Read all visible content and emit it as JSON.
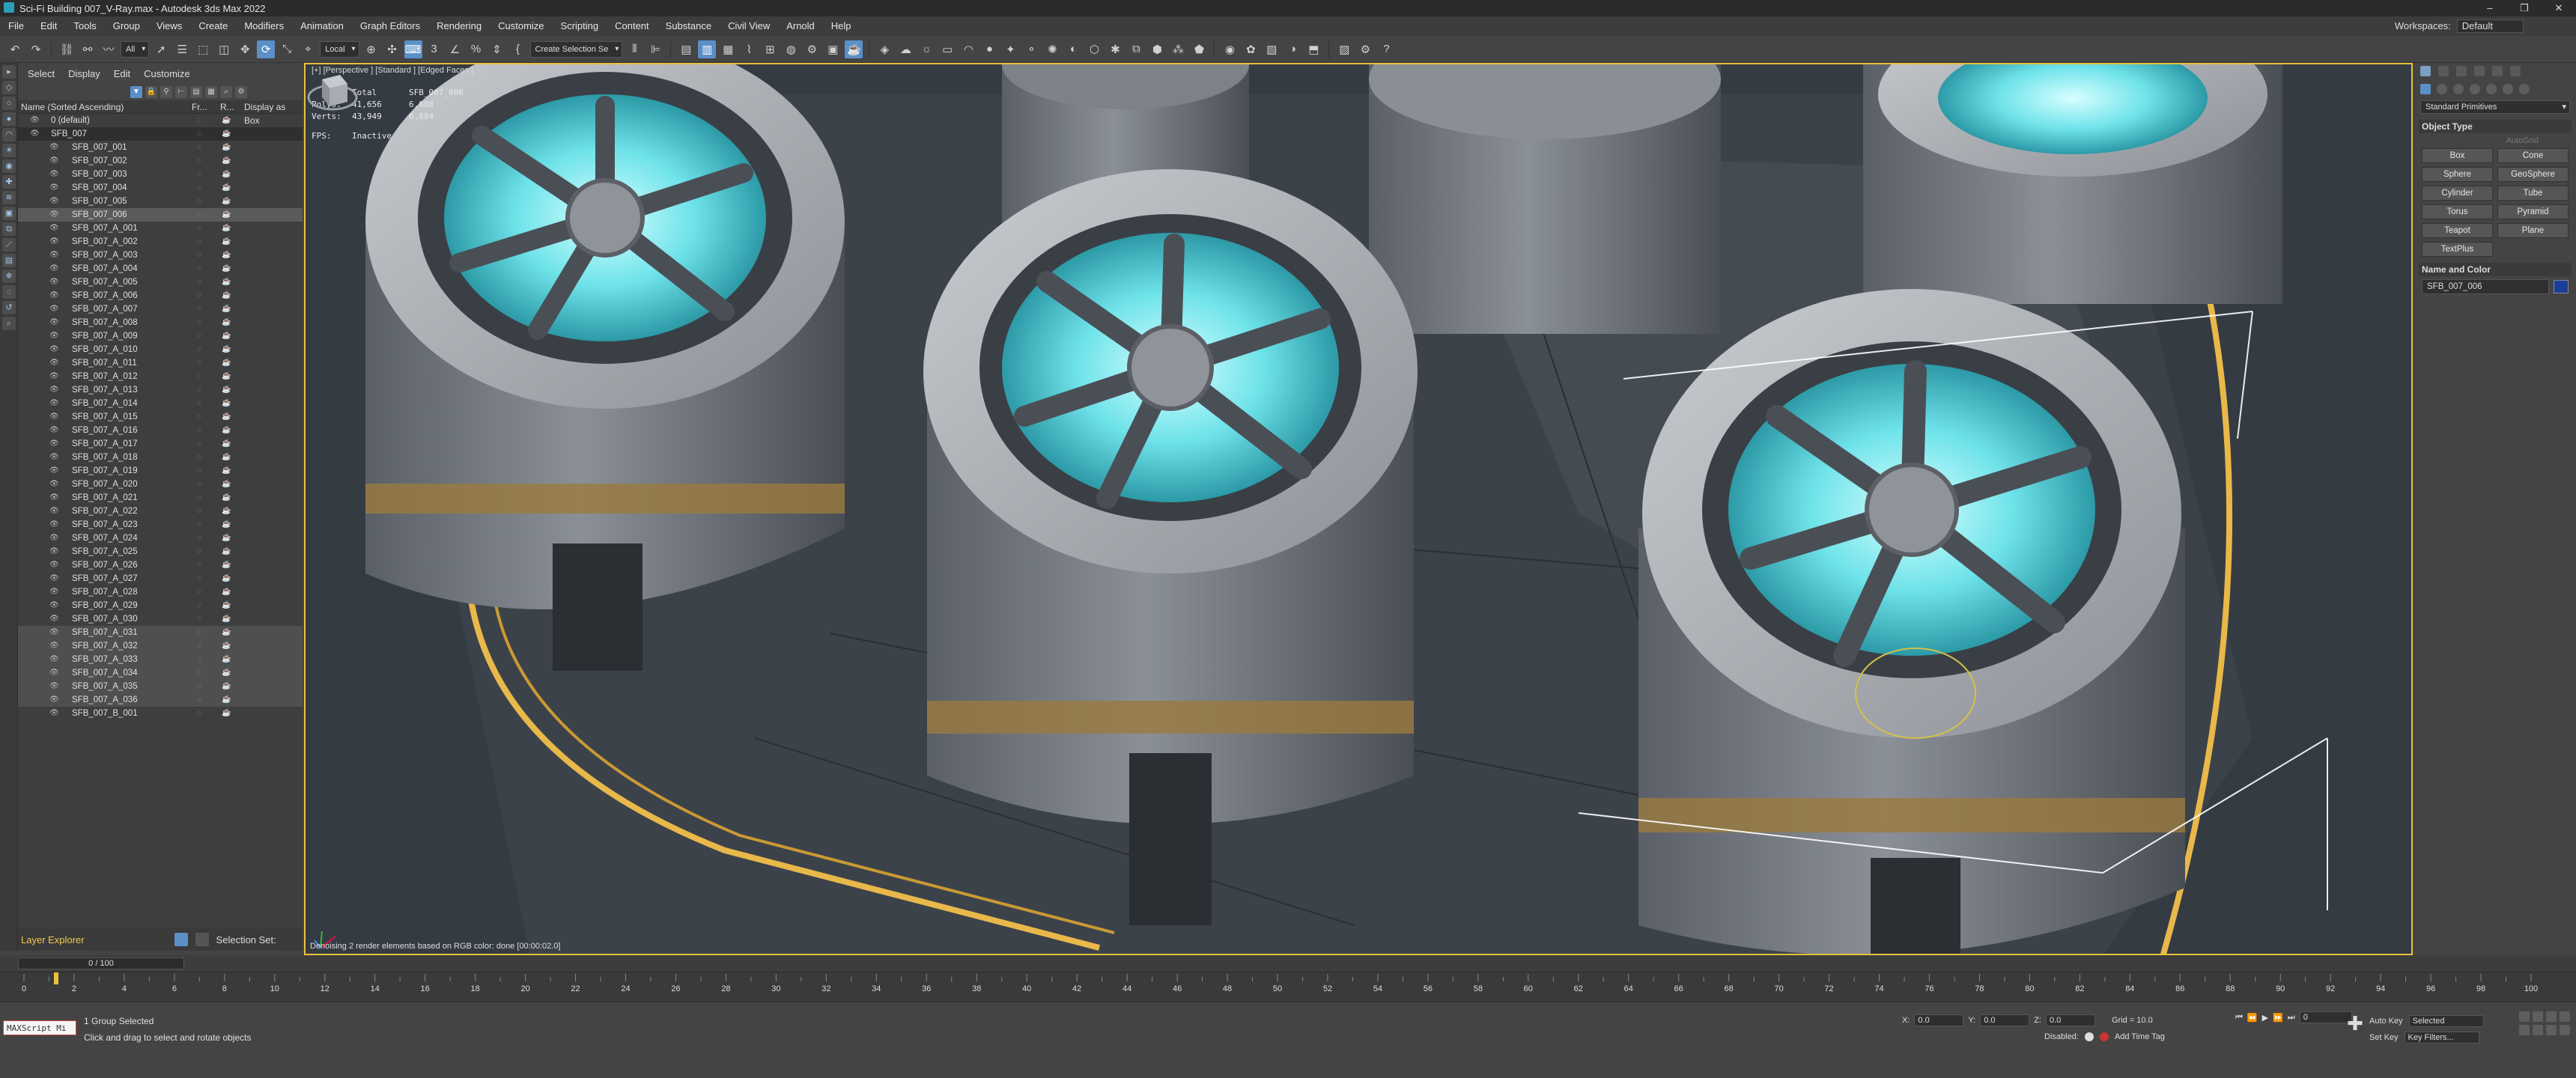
{
  "window": {
    "title": "Sci-Fi Building 007_V-Ray.max - Autodesk 3ds Max 2022",
    "controls": [
      "–",
      "❐",
      "✕"
    ]
  },
  "menu": {
    "items": [
      "File",
      "Edit",
      "Tools",
      "Group",
      "Views",
      "Create",
      "Modifiers",
      "Animation",
      "Graph Editors",
      "Rendering",
      "Customize",
      "Scripting",
      "Content",
      "Substance",
      "Civil View",
      "Arnold",
      "Help"
    ],
    "workspaces_label": "Workspaces:",
    "workspaces_value": "Default"
  },
  "toolbar": {
    "filter_value": "All",
    "ref_coord_value": "Local",
    "selection_set_value": "Create Selection Se"
  },
  "scene_explorer": {
    "menu": [
      "Select",
      "Display",
      "Edit",
      "Customize"
    ],
    "columns": [
      "Name (Sorted Ascending)",
      "Fr...",
      "R...",
      "Display as Box"
    ],
    "rows": [
      {
        "name": "0 (default)",
        "level": 1,
        "type": "layer"
      },
      {
        "name": "SFB_007",
        "level": 1,
        "type": "layer",
        "state": "highlight"
      },
      {
        "name": "SFB_007_001",
        "level": 2
      },
      {
        "name": "SFB_007_002",
        "level": 2
      },
      {
        "name": "SFB_007_003",
        "level": 2
      },
      {
        "name": "SFB_007_004",
        "level": 2
      },
      {
        "name": "SFB_007_005",
        "level": 2
      },
      {
        "name": "SFB_007_006",
        "level": 2,
        "state": "selected"
      },
      {
        "name": "SFB_007_A_001",
        "level": 2
      },
      {
        "name": "SFB_007_A_002",
        "level": 2
      },
      {
        "name": "SFB_007_A_003",
        "level": 2
      },
      {
        "name": "SFB_007_A_004",
        "level": 2
      },
      {
        "name": "SFB_007_A_005",
        "level": 2
      },
      {
        "name": "SFB_007_A_006",
        "level": 2
      },
      {
        "name": "SFB_007_A_007",
        "level": 2
      },
      {
        "name": "SFB_007_A_008",
        "level": 2
      },
      {
        "name": "SFB_007_A_009",
        "level": 2
      },
      {
        "name": "SFB_007_A_010",
        "level": 2
      },
      {
        "name": "SFB_007_A_011",
        "level": 2
      },
      {
        "name": "SFB_007_A_012",
        "level": 2
      },
      {
        "name": "SFB_007_A_013",
        "level": 2
      },
      {
        "name": "SFB_007_A_014",
        "level": 2
      },
      {
        "name": "SFB_007_A_015",
        "level": 2
      },
      {
        "name": "SFB_007_A_016",
        "level": 2
      },
      {
        "name": "SFB_007_A_017",
        "level": 2
      },
      {
        "name": "SFB_007_A_018",
        "level": 2
      },
      {
        "name": "SFB_007_A_019",
        "level": 2
      },
      {
        "name": "SFB_007_A_020",
        "level": 2
      },
      {
        "name": "SFB_007_A_021",
        "level": 2
      },
      {
        "name": "SFB_007_A_022",
        "level": 2
      },
      {
        "name": "SFB_007_A_023",
        "level": 2
      },
      {
        "name": "SFB_007_A_024",
        "level": 2
      },
      {
        "name": "SFB_007_A_025",
        "level": 2
      },
      {
        "name": "SFB_007_A_026",
        "level": 2
      },
      {
        "name": "SFB_007_A_027",
        "level": 2
      },
      {
        "name": "SFB_007_A_028",
        "level": 2
      },
      {
        "name": "SFB_007_A_029",
        "level": 2
      },
      {
        "name": "SFB_007_A_030",
        "level": 2
      },
      {
        "name": "SFB_007_A_031",
        "level": 2,
        "state": "group"
      },
      {
        "name": "SFB_007_A_032",
        "level": 2,
        "state": "group"
      },
      {
        "name": "SFB_007_A_033",
        "level": 2,
        "state": "group"
      },
      {
        "name": "SFB_007_A_034",
        "level": 2,
        "state": "group"
      },
      {
        "name": "SFB_007_A_035",
        "level": 2,
        "state": "group"
      },
      {
        "name": "SFB_007_A_036",
        "level": 2,
        "state": "group"
      },
      {
        "name": "SFB_007_B_001",
        "level": 2
      }
    ],
    "footer_label": "Layer Explorer",
    "selection_set_label": "Selection Set:"
  },
  "viewport": {
    "label": "[+] [Perspective ] [Standard ] [Edged Faces ]",
    "stats": {
      "header": [
        "Total",
        "SFB_007_006"
      ],
      "polys_label": "Polys:",
      "polys_total": "41,656",
      "polys_sel": "6,608",
      "verts_label": "Verts:",
      "verts_total": "43,949",
      "verts_sel": "6,884",
      "fps_label": "FPS:",
      "fps_value": "Inactive"
    },
    "status_message": "Denoising 2 render elements based on RGB color: done [00:00:02.0]"
  },
  "command_panel": {
    "category_value": "Standard Primitives",
    "object_type_title": "Object Type",
    "autogrid_label": "AutoGrid",
    "buttons": [
      "Box",
      "Cone",
      "Sphere",
      "GeoSphere",
      "Cylinder",
      "Tube",
      "Torus",
      "Pyramid",
      "Teapot",
      "Plane",
      "TextPlus"
    ],
    "name_color_title": "Name and Color",
    "name_value": "SFB_007_006",
    "color": "#1b3e9a"
  },
  "timeline": {
    "slider_label": "0 / 100",
    "ticks": [
      0,
      2,
      4,
      6,
      8,
      10,
      12,
      14,
      16,
      18,
      20,
      22,
      24,
      26,
      28,
      30,
      32,
      34,
      36,
      38,
      40,
      42,
      44,
      46,
      48,
      50,
      52,
      54,
      56,
      58,
      60,
      62,
      64,
      66,
      68,
      70,
      72,
      74,
      76,
      78,
      80,
      82,
      84,
      86,
      88,
      90,
      92,
      94,
      96,
      98,
      100
    ]
  },
  "status": {
    "maxscript_label": "MAXScript Mi",
    "line1": "1 Group Selected",
    "line2": "Click and drag to select and rotate objects",
    "x_label": "X:",
    "x_value": "0.0",
    "y_label": "Y:",
    "y_value": "0.0",
    "z_label": "Z:",
    "z_value": "0.0",
    "grid_label": "Grid = 10.0",
    "disabled_label": "Disabled:",
    "add_time_tag": "Add Time Tag",
    "frame_value": "0",
    "auto_key_label": "Auto Key",
    "auto_key_value": "Selected",
    "set_key_label": "Set Key",
    "key_filters_label": "Key Filters..."
  }
}
